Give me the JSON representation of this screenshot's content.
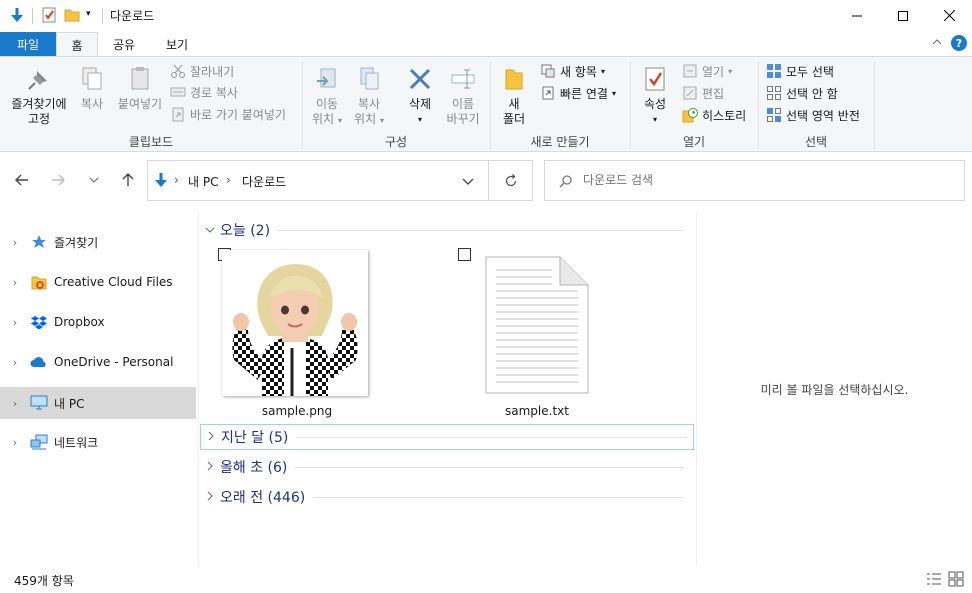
{
  "window": {
    "title": "다운로드"
  },
  "ribbon_tabs": {
    "file": "파일",
    "home": "홈",
    "share": "공유",
    "view": "보기"
  },
  "ribbon": {
    "clipboard": {
      "pin": "즐겨찾기에\n고정",
      "pin_l1": "즐겨찾기에",
      "pin_l2": "고정",
      "copy": "복사",
      "paste": "붙여넣기",
      "cut": "잘라내기",
      "copy_path": "경로 복사",
      "paste_shortcut": "바로 가기 붙여넣기",
      "label": "클립보드"
    },
    "organize": {
      "move_l1": "이동",
      "move_l2": "위치",
      "copyto_l1": "복사",
      "copyto_l2": "위치",
      "delete": "삭제",
      "rename_l1": "이름",
      "rename_l2": "바꾸기",
      "label": "구성"
    },
    "new": {
      "folder_l1": "새",
      "folder_l2": "폴더",
      "new_item": "새 항목",
      "easy_access": "빠른 연결",
      "label": "새로 만들기"
    },
    "open": {
      "properties": "속성",
      "open": "열기",
      "edit": "편집",
      "history": "히스토리",
      "label": "열기"
    },
    "select": {
      "select_all": "모두 선택",
      "select_none": "선택 안 함",
      "invert": "선택 영역 반전",
      "label": "선택"
    }
  },
  "address": {
    "pc": "내 PC",
    "folder": "다운로드",
    "sep": "›"
  },
  "search": {
    "placeholder": "다운로드 검색"
  },
  "sidebar": {
    "items": [
      {
        "label": "즐겨찾기"
      },
      {
        "label": "Creative Cloud Files"
      },
      {
        "label": "Dropbox"
      },
      {
        "label": "OneDrive - Personal"
      },
      {
        "label": "내 PC"
      },
      {
        "label": "네트워크"
      }
    ]
  },
  "groups": [
    {
      "label": "오늘 (2)"
    },
    {
      "label": "지난 달 (5)"
    },
    {
      "label": "올해 초 (6)"
    },
    {
      "label": "오래 전 (446)"
    }
  ],
  "files": [
    {
      "name": "sample.png"
    },
    {
      "name": "sample.txt"
    }
  ],
  "preview": {
    "message": "미리 볼 파일을 선택하십시오."
  },
  "status": {
    "count": "459개 항목"
  },
  "colors": {
    "accent": "#1979ca",
    "selected_bg": "#d9d9d9",
    "group_text": "#1e3287"
  }
}
